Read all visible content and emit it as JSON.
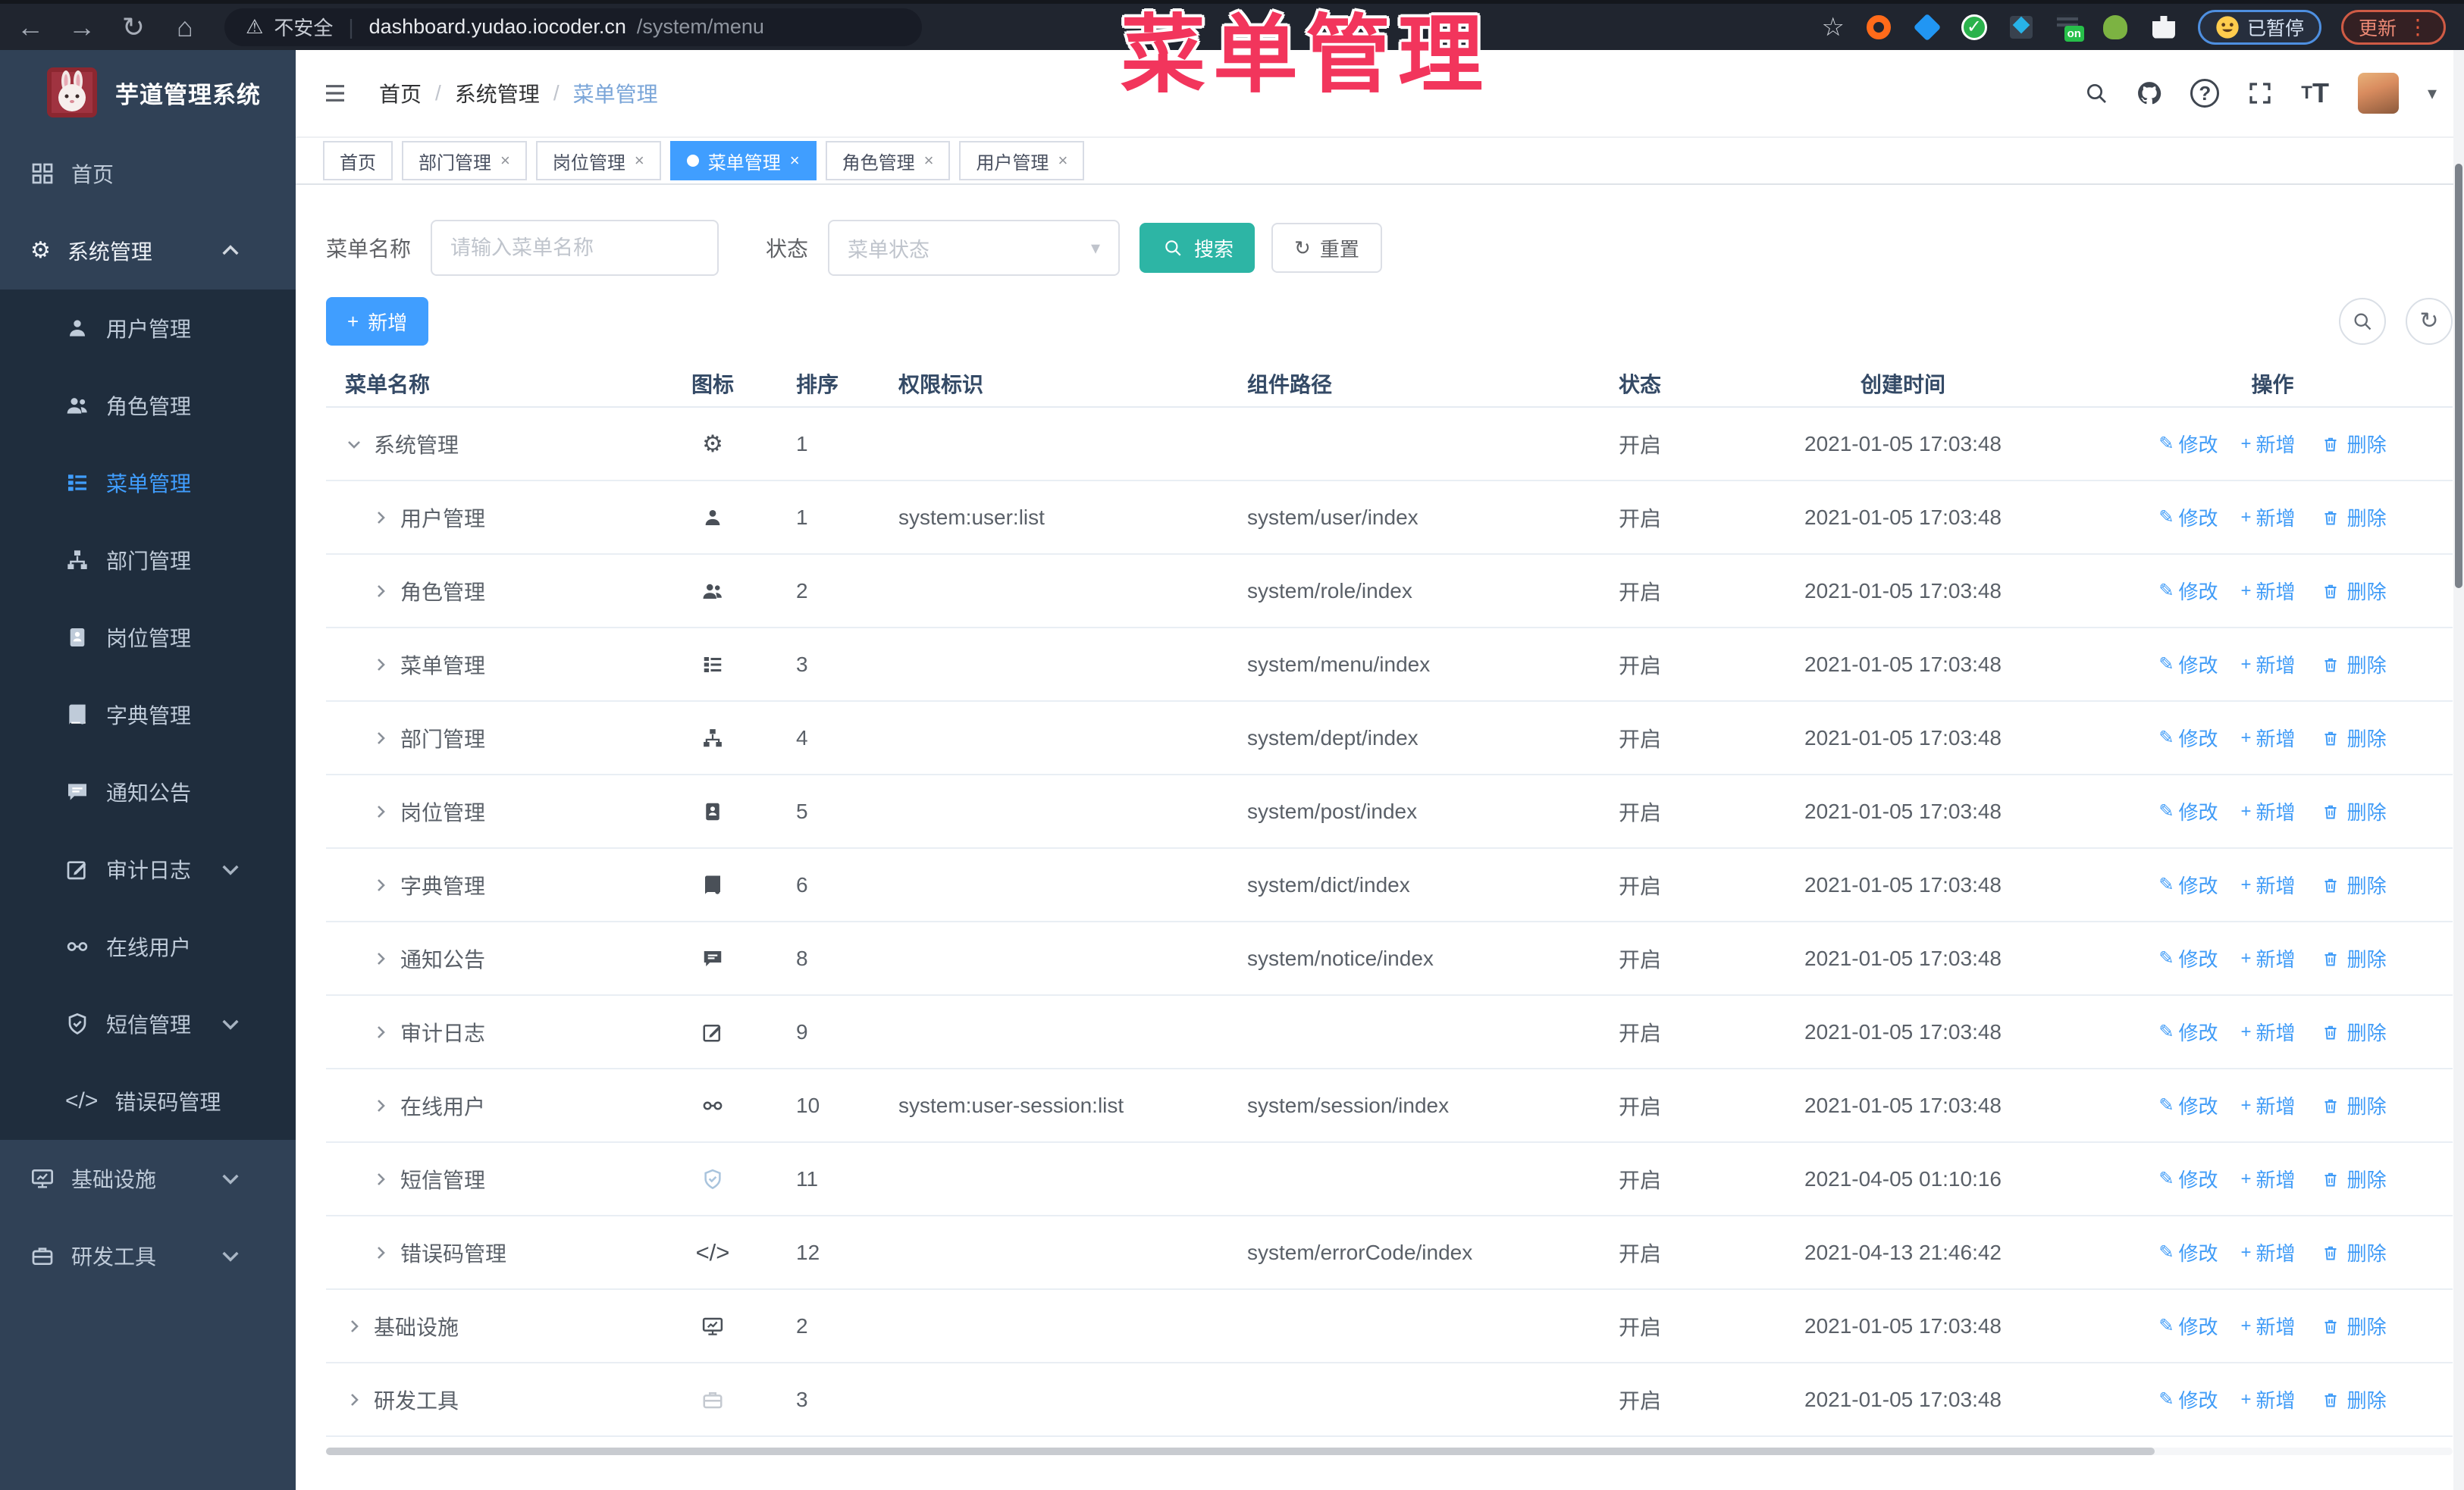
{
  "browser": {
    "security_label": "不安全",
    "url_host": "dashboard.yudao.iocoder.cn",
    "url_path": "/system/menu",
    "paused_badge": "已暂停",
    "update_badge": "更新",
    "on_badge": "on"
  },
  "overlay_title": "菜单管理",
  "sidebar": {
    "logo_title": "芋道管理系统",
    "items": [
      {
        "id": "home",
        "label": "首页",
        "icon": "dashboard-icon",
        "sub": false,
        "caret": null,
        "active": false
      },
      {
        "id": "system",
        "label": "系统管理",
        "icon": "gear-icon",
        "sub": false,
        "caret": "up",
        "active": false,
        "open": true
      },
      {
        "id": "user",
        "label": "用户管理",
        "icon": "user-icon",
        "sub": true,
        "caret": null,
        "active": false
      },
      {
        "id": "role",
        "label": "角色管理",
        "icon": "users-icon",
        "sub": true,
        "caret": null,
        "active": false
      },
      {
        "id": "menu",
        "label": "菜单管理",
        "icon": "menu-icon",
        "sub": true,
        "caret": null,
        "active": true
      },
      {
        "id": "dept",
        "label": "部门管理",
        "icon": "org-icon",
        "sub": true,
        "caret": null,
        "active": false
      },
      {
        "id": "post",
        "label": "岗位管理",
        "icon": "badge-icon",
        "sub": true,
        "caret": null,
        "active": false
      },
      {
        "id": "dict",
        "label": "字典管理",
        "icon": "dict-icon",
        "sub": true,
        "caret": null,
        "active": false
      },
      {
        "id": "notice",
        "label": "通知公告",
        "icon": "message-icon",
        "sub": true,
        "caret": null,
        "active": false
      },
      {
        "id": "audit",
        "label": "审计日志",
        "icon": "audit-icon",
        "sub": true,
        "caret": "down",
        "active": false
      },
      {
        "id": "session",
        "label": "在线用户",
        "icon": "link-icon",
        "sub": true,
        "caret": null,
        "active": false
      },
      {
        "id": "sms",
        "label": "短信管理",
        "icon": "shield-check-icon",
        "sub": true,
        "caret": "down",
        "active": false
      },
      {
        "id": "errcode",
        "label": "错误码管理",
        "icon": "code-icon",
        "sub": true,
        "caret": null,
        "active": false
      },
      {
        "id": "infra",
        "label": "基础设施",
        "icon": "monitor-icon",
        "sub": false,
        "caret": "down",
        "active": false
      },
      {
        "id": "tool",
        "label": "研发工具",
        "icon": "toolbox-icon",
        "sub": false,
        "caret": "down",
        "active": false
      }
    ]
  },
  "header": {
    "breadcrumb": [
      "首页",
      "系统管理",
      "菜单管理"
    ]
  },
  "tabs": [
    {
      "label": "首页",
      "closable": false,
      "active": false
    },
    {
      "label": "部门管理",
      "closable": true,
      "active": false
    },
    {
      "label": "岗位管理",
      "closable": true,
      "active": false
    },
    {
      "label": "菜单管理",
      "closable": true,
      "active": true
    },
    {
      "label": "角色管理",
      "closable": true,
      "active": false
    },
    {
      "label": "用户管理",
      "closable": true,
      "active": false
    }
  ],
  "filters": {
    "name_label": "菜单名称",
    "name_placeholder": "请输入菜单名称",
    "name_value": "",
    "status_label": "状态",
    "status_placeholder": "菜单状态",
    "search_label": "搜索",
    "reset_label": "重置"
  },
  "toolbar": {
    "add_label": "新增"
  },
  "table": {
    "columns": [
      {
        "label": "菜单名称",
        "cls": "c-name"
      },
      {
        "label": "图标",
        "cls": "c-icon"
      },
      {
        "label": "排序",
        "cls": "c-sort"
      },
      {
        "label": "权限标识",
        "cls": "c-perm"
      },
      {
        "label": "组件路径",
        "cls": "c-path"
      },
      {
        "label": "状态",
        "cls": "c-status"
      },
      {
        "label": "创建时间",
        "cls": "c-time"
      },
      {
        "label": "操作",
        "cls": "c-act"
      }
    ],
    "actions": [
      {
        "label": "修改",
        "icon": "edit-pen-icon"
      },
      {
        "label": "新增",
        "icon": "plus-icon"
      },
      {
        "label": "删除",
        "icon": "trash-icon"
      }
    ],
    "rows": [
      {
        "name": "系统管理",
        "level": 0,
        "expanded": true,
        "icon": "gear-icon",
        "icon_tone": "",
        "sort": "1",
        "perm": "",
        "path": "",
        "status": "开启",
        "time": "2021-01-05 17:03:48"
      },
      {
        "name": "用户管理",
        "level": 1,
        "expanded": false,
        "icon": "user-icon",
        "icon_tone": "",
        "sort": "1",
        "perm": "system:user:list",
        "path": "system/user/index",
        "status": "开启",
        "time": "2021-01-05 17:03:48"
      },
      {
        "name": "角色管理",
        "level": 1,
        "expanded": false,
        "icon": "users-icon",
        "icon_tone": "",
        "sort": "2",
        "perm": "",
        "path": "system/role/index",
        "status": "开启",
        "time": "2021-01-05 17:03:48"
      },
      {
        "name": "菜单管理",
        "level": 1,
        "expanded": false,
        "icon": "menu-icon",
        "icon_tone": "",
        "sort": "3",
        "perm": "",
        "path": "system/menu/index",
        "status": "开启",
        "time": "2021-01-05 17:03:48"
      },
      {
        "name": "部门管理",
        "level": 1,
        "expanded": false,
        "icon": "org-icon",
        "icon_tone": "",
        "sort": "4",
        "perm": "",
        "path": "system/dept/index",
        "status": "开启",
        "time": "2021-01-05 17:03:48"
      },
      {
        "name": "岗位管理",
        "level": 1,
        "expanded": false,
        "icon": "badge-icon",
        "icon_tone": "",
        "sort": "5",
        "perm": "",
        "path": "system/post/index",
        "status": "开启",
        "time": "2021-01-05 17:03:48"
      },
      {
        "name": "字典管理",
        "level": 1,
        "expanded": false,
        "icon": "dict-icon",
        "icon_tone": "",
        "sort": "6",
        "perm": "",
        "path": "system/dict/index",
        "status": "开启",
        "time": "2021-01-05 17:03:48"
      },
      {
        "name": "通知公告",
        "level": 1,
        "expanded": false,
        "icon": "message-icon",
        "icon_tone": "",
        "sort": "8",
        "perm": "",
        "path": "system/notice/index",
        "status": "开启",
        "time": "2021-01-05 17:03:48"
      },
      {
        "name": "审计日志",
        "level": 1,
        "expanded": false,
        "icon": "audit-icon",
        "icon_tone": "",
        "sort": "9",
        "perm": "",
        "path": "",
        "status": "开启",
        "time": "2021-01-05 17:03:48"
      },
      {
        "name": "在线用户",
        "level": 1,
        "expanded": false,
        "icon": "link-icon",
        "icon_tone": "",
        "sort": "10",
        "perm": "system:user-session:list",
        "path": "system/session/index",
        "status": "开启",
        "time": "2021-01-05 17:03:48"
      },
      {
        "name": "短信管理",
        "level": 1,
        "expanded": false,
        "icon": "shield-check-icon",
        "icon_tone": "muted",
        "sort": "11",
        "perm": "",
        "path": "",
        "status": "开启",
        "time": "2021-04-05 01:10:16"
      },
      {
        "name": "错误码管理",
        "level": 1,
        "expanded": false,
        "icon": "code-icon",
        "icon_tone": "",
        "sort": "12",
        "perm": "",
        "path": "system/errorCode/index",
        "status": "开启",
        "time": "2021-04-13 21:46:42"
      },
      {
        "name": "基础设施",
        "level": 0,
        "expanded": false,
        "icon": "monitor-icon",
        "icon_tone": "",
        "sort": "2",
        "perm": "",
        "path": "",
        "status": "开启",
        "time": "2021-01-05 17:03:48"
      },
      {
        "name": "研发工具",
        "level": 0,
        "expanded": false,
        "icon": "toolbox-icon",
        "icon_tone": "muted2",
        "sort": "3",
        "perm": "",
        "path": "",
        "status": "开启",
        "time": "2021-01-05 17:03:48"
      }
    ]
  },
  "icons": {
    "back-icon": "char:←",
    "forward-icon": "char:→",
    "reload-icon": "char:↻",
    "home-icon": "char:⌂",
    "warning-icon": "char:⚠",
    "star-icon": "char:☆",
    "kebab-icon": "char:⋮",
    "caret-down-icon": "char:▾",
    "close-icon": "char:×",
    "dashboard-icon": "svg:i-home",
    "gear-icon": "char:⚙",
    "user-icon": "svg:i-user",
    "users-icon": "svg:i-users",
    "menu-icon": "svg:i-menu",
    "org-icon": "svg:i-org",
    "badge-icon": "svg:i-badge",
    "dict-icon": "svg:i-book",
    "message-icon": "svg:i-msg",
    "audit-icon": "svg:i-edit",
    "link-icon": "svg:i-link",
    "shield-check-icon": "svg:i-shield",
    "code-icon": "char:</>",
    "monitor-icon": "svg:i-monitor",
    "toolbox-icon": "svg:i-case",
    "chevron-up-icon": "svg:i-chev",
    "chevron-down-icon": "svg:i-chev",
    "chevron-right-icon": "svg:i-chev",
    "search-icon": "svg:i-search",
    "refresh-icon": "char:↻",
    "plus-icon": "char:+",
    "edit-pen-icon": "char:✎",
    "trash-icon": "svg:i-trash",
    "github-icon": "svg:i-github",
    "fullscreen-icon": "svg:i-fullscreen"
  },
  "colors": {
    "accent": "#409eff",
    "teal": "#2db5a5",
    "sidebar": "#304156",
    "sidebar_sub": "#1f2d3d",
    "danger_overlay": "#f2355c"
  }
}
